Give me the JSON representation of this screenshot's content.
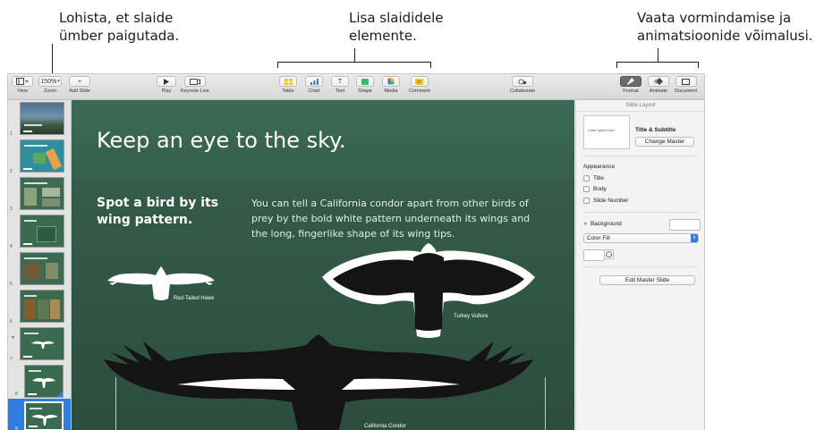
{
  "callouts": {
    "left": {
      "line1": "Lohista, et slaide",
      "line2": "ümber paigutada."
    },
    "middle": {
      "line1": "Lisa slaididele",
      "line2": "elemente."
    },
    "right": {
      "line1": "Vaata vormindamise ja",
      "line2": "animatsioonide võimalusi."
    }
  },
  "toolbar": {
    "view": {
      "label": "View",
      "icon": "sidebar-view-icon"
    },
    "zoom": {
      "label": "Zoom",
      "value": "150%"
    },
    "add_slide": {
      "label": "Add Slide",
      "icon": "plus-icon"
    },
    "play": {
      "label": "Play",
      "icon": "play-icon"
    },
    "keynote_live": {
      "label": "Keynote Live",
      "icon": "keynote-live-icon"
    },
    "table": {
      "label": "Table",
      "icon": "table-icon"
    },
    "chart": {
      "label": "Chart",
      "icon": "chart-icon"
    },
    "text": {
      "label": "Text",
      "icon": "text-icon",
      "glyph": "T"
    },
    "shape": {
      "label": "Shape",
      "icon": "shape-icon"
    },
    "media": {
      "label": "Media",
      "icon": "media-icon"
    },
    "comment": {
      "label": "Comment",
      "icon": "comment-icon"
    },
    "collaborate": {
      "label": "Collaborate",
      "icon": "collaborate-icon"
    },
    "format": {
      "label": "Format",
      "icon": "paintbrush-icon"
    },
    "animate": {
      "label": "Animate",
      "icon": "animate-icon"
    },
    "document": {
      "label": "Document",
      "icon": "document-icon"
    }
  },
  "navigator": {
    "slides": [
      {
        "number": "1"
      },
      {
        "number": "2"
      },
      {
        "number": "3"
      },
      {
        "number": "4"
      },
      {
        "number": "5"
      },
      {
        "number": "6"
      },
      {
        "number": "7"
      },
      {
        "number": "8"
      },
      {
        "number": "9"
      }
    ],
    "selected_slide": "9"
  },
  "slide": {
    "title": "Keep an eye to the sky.",
    "subtitle": "Spot a bird by its wing pattern.",
    "body": "You can tell a California condor apart from other birds of prey by the bold white pattern underneath its wings and the long, fingerlike shape of its wing tips.",
    "bird_labels": {
      "hawk": "Red-Tailed Hawk",
      "vulture": "Turkey Vulture",
      "condor": "California Condor"
    }
  },
  "inspector": {
    "header": "Slide Layout",
    "layout_name": "Title & Subtitle",
    "preview_text": "Lorem Ipsum Dolor",
    "change_master": "Change Master",
    "appearance_heading": "Appearance",
    "checkboxes": [
      {
        "label": "Title",
        "checked": false
      },
      {
        "label": "Body",
        "checked": false
      },
      {
        "label": "Slide Number",
        "checked": false
      }
    ],
    "background_heading": "Background",
    "fill_select": "Color Fill",
    "edit_master": "Edit Master Slide"
  },
  "colors": {
    "slide_background": "#315540",
    "selection_blue": "#2f7de1",
    "toolbar_yellow": "#f5c530"
  }
}
